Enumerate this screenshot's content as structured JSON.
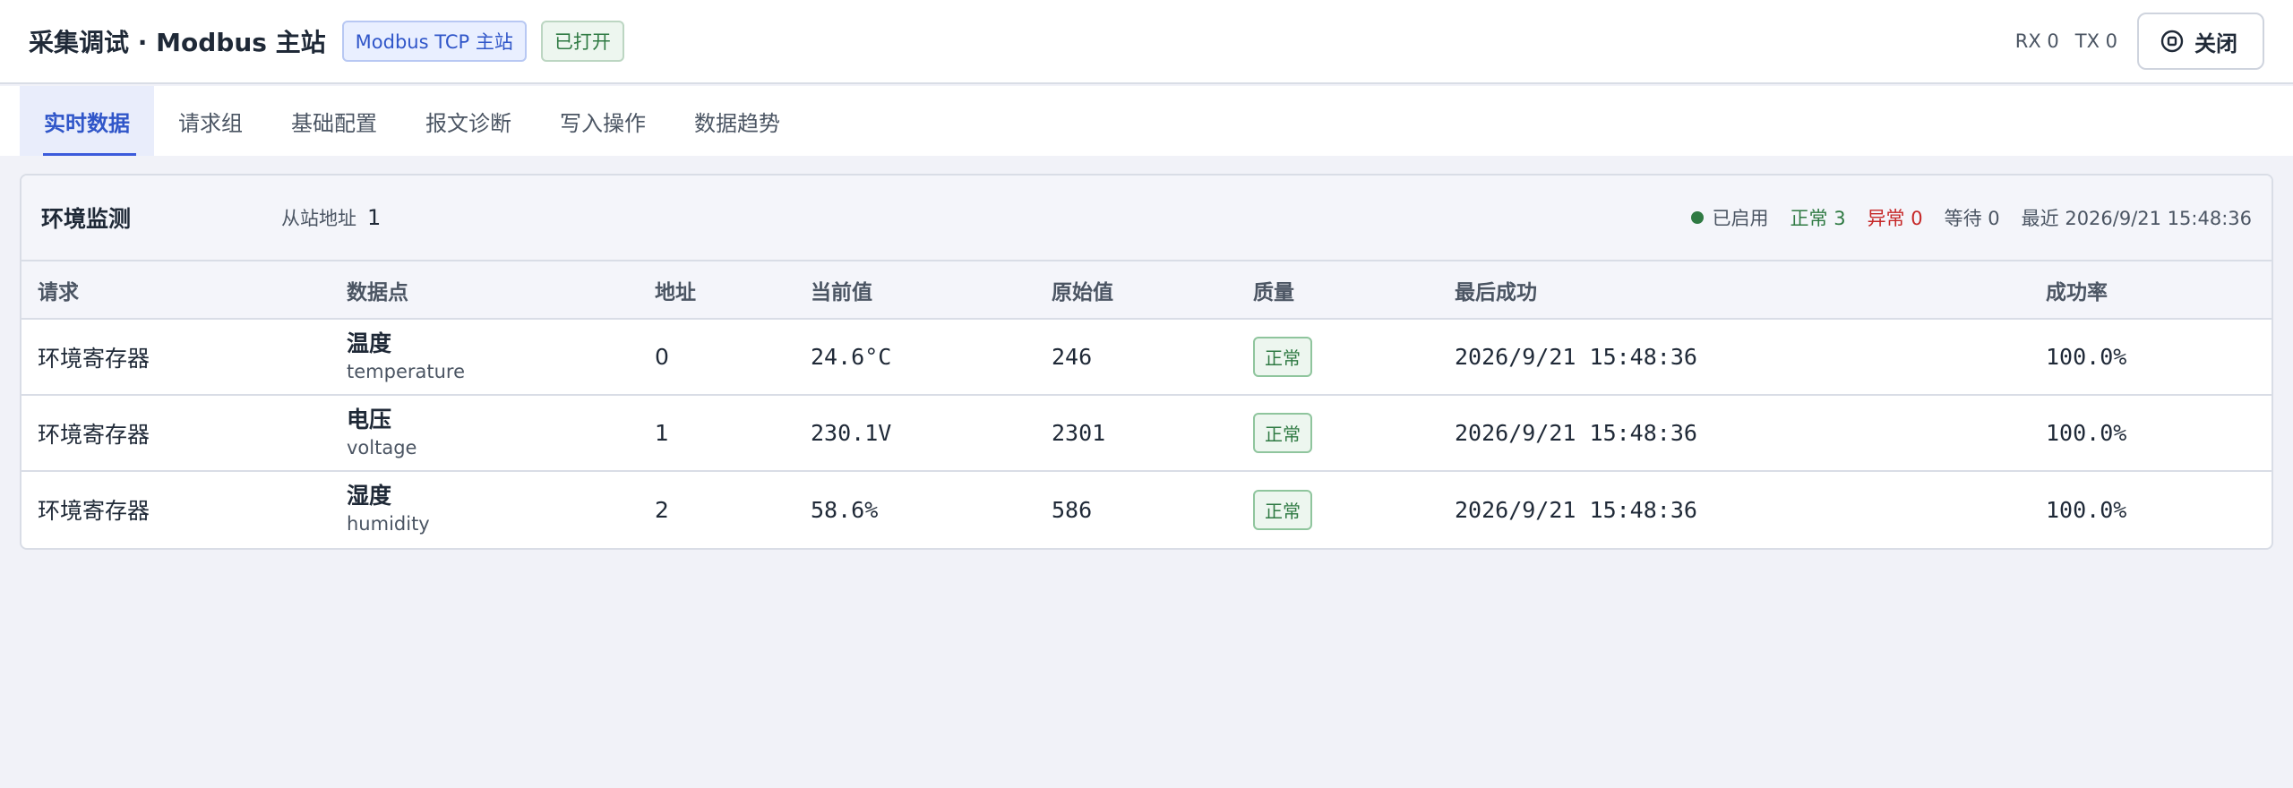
{
  "header": {
    "title": "采集调试 · Modbus 主站",
    "protocol_badge": "Modbus TCP 主站",
    "state_badge": "已打开",
    "rx": "RX 0",
    "tx": "TX 0",
    "close_label": "关闭"
  },
  "tabs": [
    {
      "label": "实时数据",
      "active": true
    },
    {
      "label": "请求组",
      "active": false
    },
    {
      "label": "基础配置",
      "active": false
    },
    {
      "label": "报文诊断",
      "active": false
    },
    {
      "label": "写入操作",
      "active": false
    },
    {
      "label": "数据趋势",
      "active": false
    }
  ],
  "group": {
    "name": "环境监测",
    "slave_label": "从站地址",
    "slave_value": "1",
    "enabled": "已启用",
    "ok": "正常 3",
    "error": "异常 0",
    "waiting": "等待 0",
    "latest": "最近 2026/9/21 15:48:36"
  },
  "table": {
    "columns": [
      "请求",
      "数据点",
      "地址",
      "当前值",
      "原始值",
      "质量",
      "最后成功",
      "成功率"
    ],
    "rows": [
      {
        "request": "环境寄存器",
        "point": "温度",
        "key": "temperature",
        "address": "0",
        "value": "24.6°C",
        "raw": "246",
        "quality": "正常",
        "last_success": "2026/9/21 15:48:36",
        "rate": "100.0%"
      },
      {
        "request": "环境寄存器",
        "point": "电压",
        "key": "voltage",
        "address": "1",
        "value": "230.1V",
        "raw": "2301",
        "quality": "正常",
        "last_success": "2026/9/21 15:48:36",
        "rate": "100.0%"
      },
      {
        "request": "环境寄存器",
        "point": "湿度",
        "key": "humidity",
        "address": "2",
        "value": "58.6%",
        "raw": "586",
        "quality": "正常",
        "last_success": "2026/9/21 15:48:36",
        "rate": "100.0%"
      }
    ]
  },
  "colors": {
    "accent": "#3b5bdb",
    "ok": "#2f7a43",
    "error": "#c62828"
  }
}
